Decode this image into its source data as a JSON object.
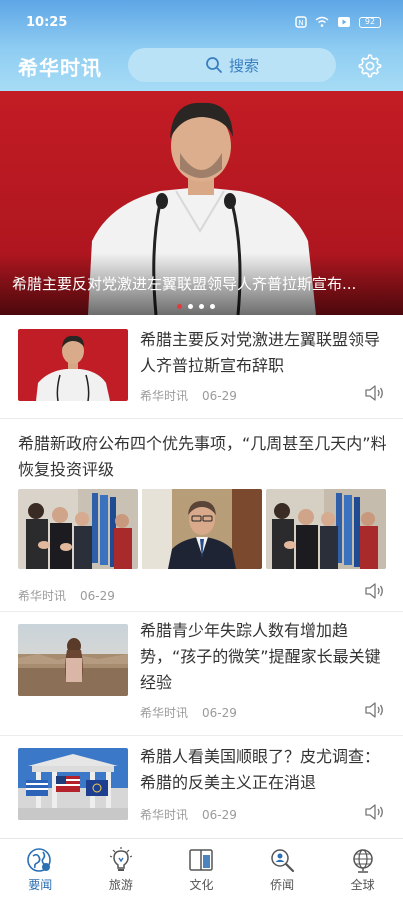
{
  "status_bar": {
    "time": "10:25",
    "battery": "92"
  },
  "header": {
    "logo": "希华时讯",
    "search_label": "搜索",
    "search_icon": "search-icon",
    "settings_icon": "gear-icon"
  },
  "hero": {
    "caption": "希腊主要反对党激进左翼联盟领导人齐普拉斯宣布...",
    "slide_count": 4,
    "active_slide": 1
  },
  "feed": [
    {
      "title": "希腊主要反对党激进左翼联盟领导人齐普拉斯宣布辞职",
      "source": "希华时讯",
      "date": "06-29"
    },
    {
      "title": "希腊新政府公布四个优先事项，“几周甚至几天内”料恢复投资评级",
      "source": "希华时讯",
      "date": "06-29"
    },
    {
      "title": "希腊青少年失踪人数有增加趋势，“孩子的微笑”提醒家长最关键经验",
      "source": "希华时讯",
      "date": "06-29"
    },
    {
      "title": "希腊人看美国顺眼了？皮尤调查：希腊的反美主义正在消退",
      "source": "希华时讯",
      "date": "06-29"
    }
  ],
  "bottom_nav": [
    {
      "label": "要闻",
      "icon": "globe-news-icon",
      "active": true
    },
    {
      "label": "旅游",
      "icon": "lightbulb-icon",
      "active": false
    },
    {
      "label": "文化",
      "icon": "book-icon",
      "active": false
    },
    {
      "label": "侨闻",
      "icon": "search-person-icon",
      "active": false
    },
    {
      "label": "全球",
      "icon": "globe-icon",
      "active": false
    }
  ],
  "colors": {
    "accent": "#2c6fb3",
    "hero_red": "#c01d25",
    "header_top": "#5ea6e6"
  }
}
